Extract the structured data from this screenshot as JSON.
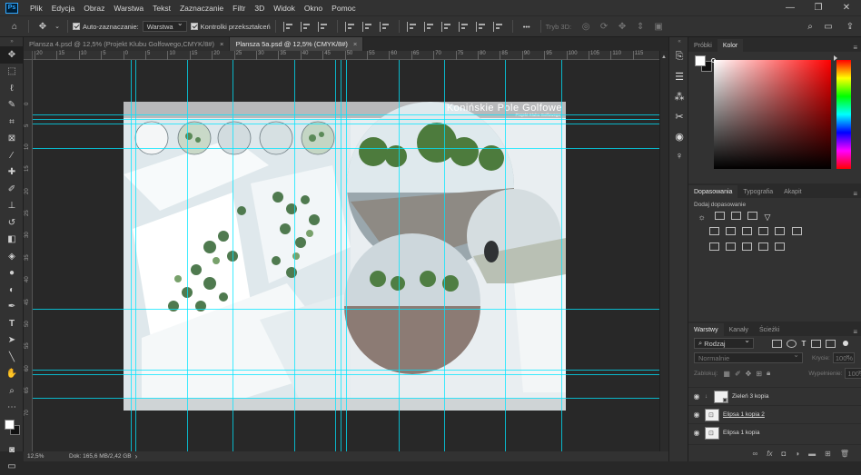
{
  "menubar": {
    "logo": "Ps",
    "items": [
      "Plik",
      "Edycja",
      "Obraz",
      "Warstwa",
      "Tekst",
      "Zaznaczanie",
      "Filtr",
      "3D",
      "Widok",
      "Okno",
      "Pomoc"
    ]
  },
  "options": {
    "auto_select_label": "Auto-zaznaczanie:",
    "auto_select_value": "Warstwa",
    "transform_label": "Kontrolki przekształceń",
    "mode_3d": "Tryb 3D:",
    "more": "•••"
  },
  "tabs": [
    {
      "label": "Plansza 4.psd @ 12,5% (Projekt Klubu Golfowego,CMYK/8#)",
      "close": "×"
    },
    {
      "label": "Plansza 5a.psd @ 12,5% (CMYK/8#)",
      "close": "×"
    }
  ],
  "ruler_top": [
    "20",
    "15",
    "10",
    "5",
    "0",
    "5",
    "10",
    "15",
    "20",
    "25",
    "30",
    "35",
    "40",
    "45",
    "50",
    "55",
    "60",
    "65",
    "70",
    "75",
    "80",
    "85",
    "90",
    "95",
    "100",
    "105",
    "110",
    "115"
  ],
  "ruler_left": [
    "0",
    "5",
    "10",
    "15",
    "20",
    "25",
    "30",
    "35",
    "40",
    "45",
    "50",
    "55",
    "60",
    "65",
    "70"
  ],
  "document": {
    "title": "Konińskie Pole Golfowe",
    "subtitle": "Projekt Klubu Golfowego"
  },
  "status": {
    "zoom": "12,5%",
    "doc_info": "Dok: 165,6 MB/2,42 GB"
  },
  "color_panel": {
    "tabs": [
      "Próbki",
      "Kolor"
    ],
    "active_tab": 1,
    "hue_color": "#ff0000"
  },
  "adjust_panel": {
    "tabs": [
      "Dopasowania",
      "Typografia",
      "Akapit"
    ],
    "active_tab": 0,
    "add_label": "Dodaj dopasowanie"
  },
  "layers_panel": {
    "tabs": [
      "Warstwy",
      "Kanały",
      "Ścieżki"
    ],
    "active_tab": 0,
    "filter_kind": "Rodzaj",
    "blend_mode": "Normalnie",
    "opacity_label": "Krycie:",
    "opacity_value": "100%",
    "lock_label": "Zablokuj:",
    "fill_label": "Wypełnienie:",
    "fill_value": "100%",
    "layers": [
      {
        "name": "Zieleń 3 kopia",
        "type": "smart"
      },
      {
        "name": "Elipsa 1 kopia 2",
        "type": "shape"
      },
      {
        "name": "Elipsa 1 kopia",
        "type": "shape"
      }
    ],
    "footer_icons": [
      "link-icon",
      "fx-icon",
      "mask-icon",
      "adjustment-icon",
      "folder-icon",
      "new-layer-icon",
      "trash-icon"
    ]
  }
}
